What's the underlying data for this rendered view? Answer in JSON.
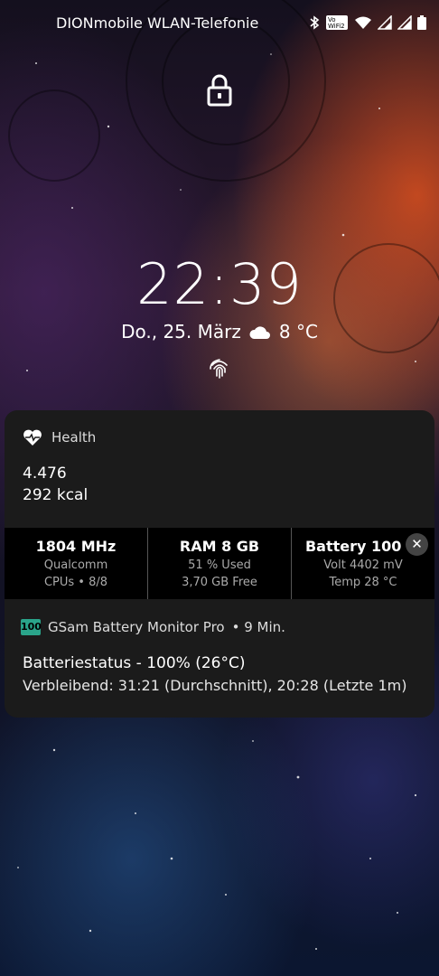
{
  "status_bar": {
    "carrier": "DIONmobile WLAN-Telefonie",
    "icons": [
      "bluetooth-icon",
      "vowifi2-icon",
      "wifi-icon",
      "signal-icon",
      "signal-icon",
      "battery-icon"
    ],
    "vowifi_label": "Vo WiFi 2"
  },
  "lockscreen": {
    "time": "22:39",
    "date": "Do., 25. März",
    "weather_icon": "partly-cloudy-icon",
    "temperature": "8 °C"
  },
  "notifications": {
    "health": {
      "app": "Health",
      "steps": "4.476",
      "kcal": "292 kcal"
    },
    "system_monitor": {
      "cpu": {
        "title": "1804 MHz",
        "line1": "Qualcomm",
        "line2": "CPUs • 8/8"
      },
      "ram": {
        "title": "RAM 8 GB",
        "line1": "51 % Used",
        "line2": "3,70 GB Free"
      },
      "battery": {
        "title": "Battery 100 %",
        "line1": "Volt 4402 mV",
        "line2": "Temp 28 °C"
      },
      "close_label": "✕"
    },
    "gsam": {
      "badge": "100",
      "app": "GSam Battery Monitor Pro",
      "time": "• 9 Min.",
      "title": "Batteriestatus - 100% (26°C)",
      "text": "Verbleibend: 31:21 (Durchschnitt), 20:28 (Letzte 1m)"
    }
  },
  "colors": {
    "card_bg": "#1b1b1b",
    "gsam_accent": "#2aa48a"
  }
}
